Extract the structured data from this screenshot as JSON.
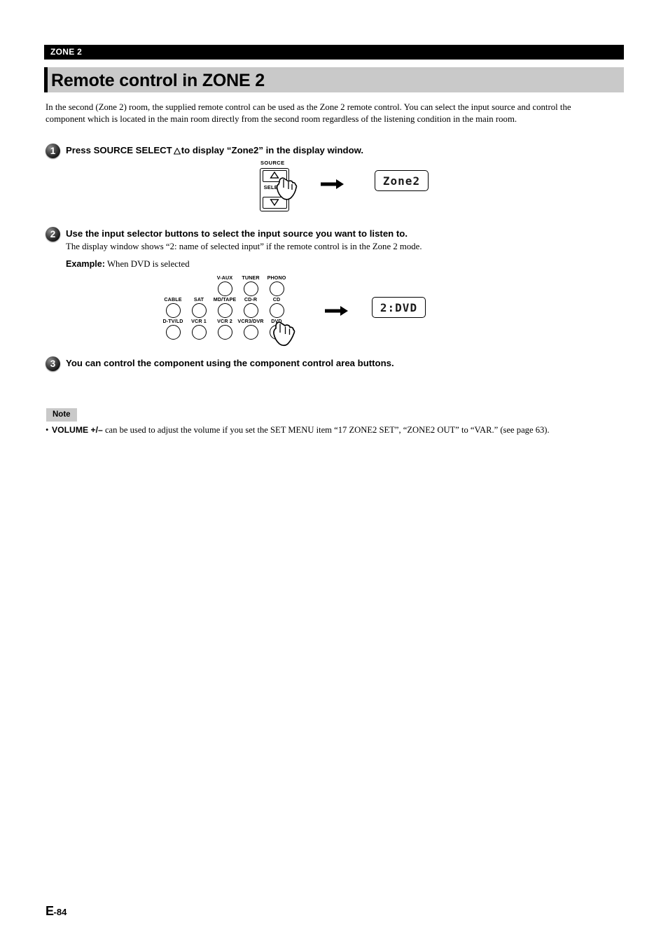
{
  "header": {
    "zone_tag": "ZONE 2",
    "title": "Remote control in ZONE 2"
  },
  "intro": "In the second (Zone 2) room, the supplied remote control can be used as the Zone 2 remote control. You can select the input source and control the component which is located in the main room directly from the second room regardless of the listening condition in the main room.",
  "steps": [
    {
      "number": "1",
      "head_before": "Press SOURCE SELECT",
      "head_after": "to display “Zone2” in the display window."
    },
    {
      "number": "2",
      "head": "Use the input selector buttons to select the input source you want to listen to.",
      "sub": "The display window shows “2: name of selected input” if the remote control is in the Zone 2 mode.",
      "example_label": "Example:",
      "example_text": "When DVD is selected"
    },
    {
      "number": "3",
      "head": "You can control the component using the component control area buttons."
    }
  ],
  "figure_source_select": {
    "caption": "SOURCE",
    "select_label": "SELECT",
    "up_glyph": "triangle-up",
    "down_glyph": "triangle-down",
    "display_text": "Zone2"
  },
  "figure_input_selector": {
    "rows": [
      [
        {
          "label": "",
          "visible": false
        },
        {
          "label": "",
          "visible": false
        },
        {
          "label": "V-AUX",
          "visible": true
        },
        {
          "label": "TUNER",
          "visible": true
        },
        {
          "label": "PHONO",
          "visible": true
        }
      ],
      [
        {
          "label": "CABLE",
          "visible": true
        },
        {
          "label": "SAT",
          "visible": true
        },
        {
          "label": "MD/TAPE",
          "visible": true
        },
        {
          "label": "CD-R",
          "visible": true
        },
        {
          "label": "CD",
          "visible": true
        }
      ],
      [
        {
          "label": "D-TV/LD",
          "visible": true
        },
        {
          "label": "VCR 1",
          "visible": true
        },
        {
          "label": "VCR 2",
          "visible": true
        },
        {
          "label": "VCR3/DVR",
          "visible": true
        },
        {
          "label": "DVD",
          "visible": true
        }
      ]
    ],
    "display_text": "2:DVD",
    "pressed_button": "DVD"
  },
  "note": {
    "tag": "Note",
    "bullet": "•",
    "strong": "VOLUME +/–",
    "text": " can be used to adjust the volume if you set the SET MENU item “17 ZONE2 SET”, “ZONE2 OUT” to “VAR.” (see page 63)."
  },
  "footer": {
    "prefix": "E",
    "page": "-84"
  }
}
